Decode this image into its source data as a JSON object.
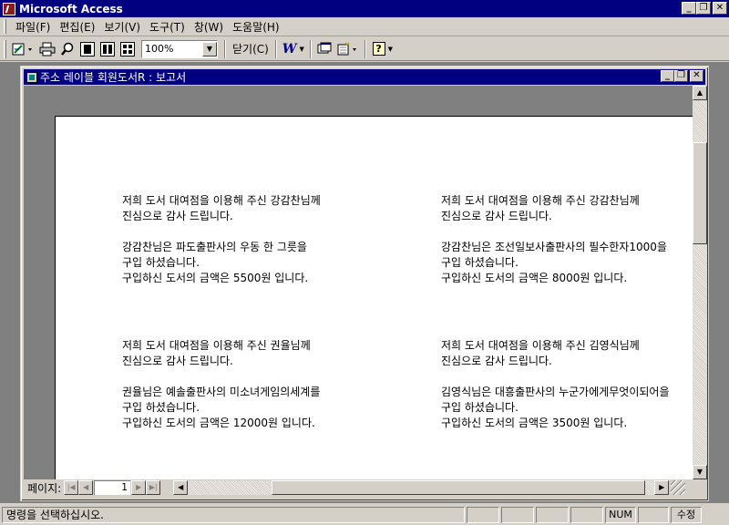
{
  "app": {
    "title": "Microsoft Access"
  },
  "title_buttons": {
    "minimize": "_",
    "restore": "❐",
    "close": "✕"
  },
  "menu": {
    "items": [
      "파일(F)",
      "편집(E)",
      "보기(V)",
      "도구(T)",
      "창(W)",
      "도움말(H)"
    ]
  },
  "toolbar": {
    "zoom_value": "100%",
    "close_label": "닫기(C)",
    "word_glyph": "W",
    "help_glyph": "?"
  },
  "report_window": {
    "title": "주소 레이블 회원도서R : 보고서"
  },
  "labels": [
    {
      "line1": "저희 도서 대여점을 이용해 주신 강감찬님께",
      "line2": "진심으로 감사 드립니다.",
      "line3": "강감찬님은 파도출판사의 우동 한 그릇을",
      "line4": "구입 하셨습니다.",
      "line5": "구입하신 도서의 금액은 5500원 입니다."
    },
    {
      "line1": "저희 도서 대여점을 이용해 주신 강감찬님께",
      "line2": "진심으로 감사 드립니다.",
      "line3": "강감찬님은 조선일보사출판사의 필수한자1000을",
      "line4": "구입 하셨습니다.",
      "line5": "구입하신 도서의 금액은 8000원 입니다."
    },
    {
      "line1": "저희 도서 대여점을 이용해 주신 권율님께",
      "line2": "진심으로 감사 드립니다.",
      "line3": "권율님은 예솔출판사의 미소녀게임의세계를",
      "line4": "구입 하셨습니다.",
      "line5": "구입하신 도서의 금액은 12000원 입니다."
    },
    {
      "line1": "저희 도서 대여점을 이용해 주신 김영식님께",
      "line2": "진심으로 감사 드립니다.",
      "line3": "김영식님은 대흥출판사의 누군가에게무엇이되어을",
      "line4": "구입 하셨습니다.",
      "line5": "구입하신 도서의 금액은 3500원 입니다."
    }
  ],
  "navigation": {
    "page_label": "페이지:",
    "page_number": "1"
  },
  "status": {
    "message": "명령을 선택하십시오.",
    "num": "NUM",
    "mode": "수정"
  }
}
